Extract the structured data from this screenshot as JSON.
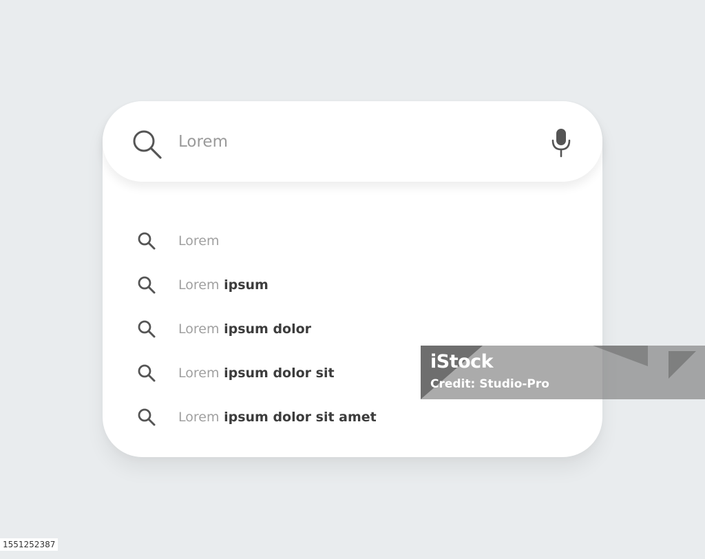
{
  "search": {
    "placeholder": "Lorem",
    "search_icon": "search-icon",
    "mic_icon": "microphone-icon"
  },
  "suggestions": [
    {
      "prefix": "Lorem",
      "completion": ""
    },
    {
      "prefix": "Lorem",
      "completion": " ipsum"
    },
    {
      "prefix": "Lorem",
      "completion": " ipsum dolor"
    },
    {
      "prefix": "Lorem",
      "completion": " ipsum dolor sit"
    },
    {
      "prefix": "Lorem",
      "completion": " ipsum dolor sit amet"
    }
  ],
  "watermark": {
    "brand": "iStock",
    "credit": "Credit: Studio-Pro"
  },
  "image_id": "1551252387",
  "colors": {
    "background": "#e9ecee",
    "card": "#ffffff",
    "placeholder_text": "#9a9a9a",
    "bold_text": "#3c3c3c",
    "icon": "#555555"
  }
}
